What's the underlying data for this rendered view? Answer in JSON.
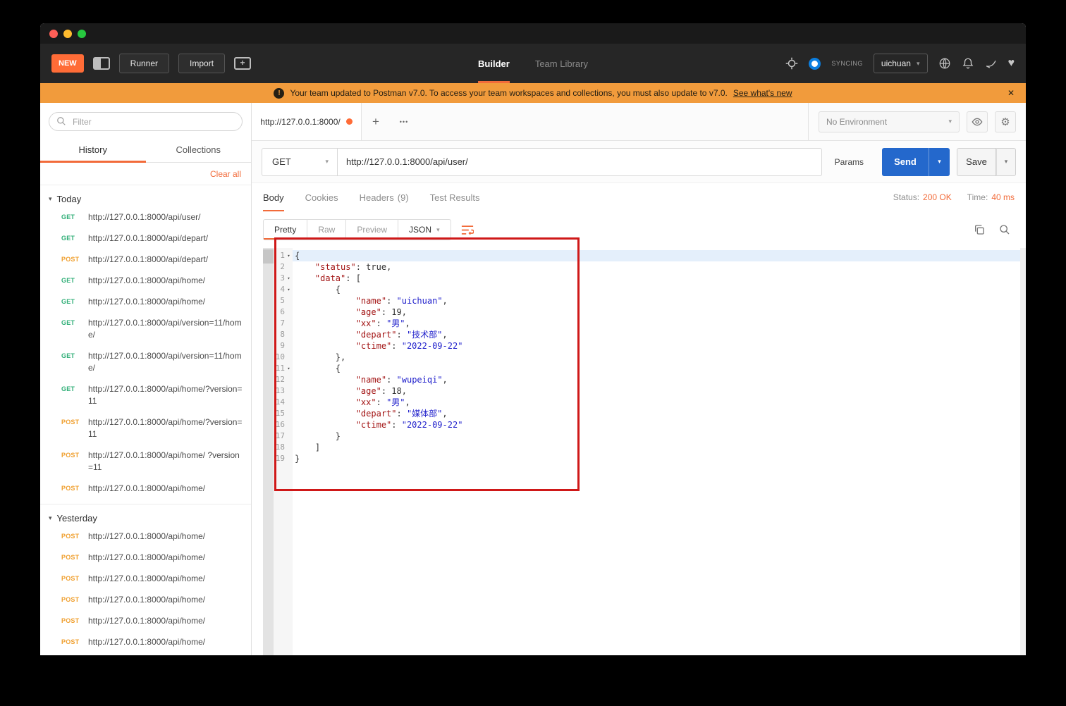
{
  "colors": {
    "accent_orange": "#f26b3a",
    "banner_orange": "#f19b3c",
    "send_blue": "#2468cc",
    "method_get_green": "#2eae76",
    "method_post_orange": "#f0a030",
    "annotation_red": "#cf1818"
  },
  "toolbar": {
    "new_label": "NEW",
    "runner_label": "Runner",
    "import_label": "Import",
    "builder_label": "Builder",
    "team_library_label": "Team Library",
    "syncing_label": "SYNCING",
    "user_label": "uichuan"
  },
  "banner": {
    "text": "Your team updated to Postman v7.0. To access your team workspaces and collections, you must also update to v7.0.",
    "link_label": "See what's new",
    "close_glyph": "✕"
  },
  "sidebar": {
    "filter_placeholder": "Filter",
    "tabs": [
      "History",
      "Collections"
    ],
    "clear_all_label": "Clear all",
    "section_fold_glyph": "▾",
    "sections": [
      {
        "label": "Today",
        "items": [
          {
            "method": "GET",
            "url": "http://127.0.0.1:8000/api/user/"
          },
          {
            "method": "GET",
            "url": "http://127.0.0.1:8000/api/depart/"
          },
          {
            "method": "POST",
            "url": "http://127.0.0.1:8000/api/depart/"
          },
          {
            "method": "GET",
            "url": "http://127.0.0.1:8000/api/home/"
          },
          {
            "method": "GET",
            "url": "http://127.0.0.1:8000/api/home/"
          },
          {
            "method": "GET",
            "url": "http://127.0.0.1:8000/api/version=11/home/"
          },
          {
            "method": "GET",
            "url": "http://127.0.0.1:8000/api/version=11/home/"
          },
          {
            "method": "GET",
            "url": "http://127.0.0.1:8000/api/home/?version=11"
          },
          {
            "method": "POST",
            "url": "http://127.0.0.1:8000/api/home/?version=11"
          },
          {
            "method": "POST",
            "url": "http://127.0.0.1:8000/api/home/ ?version=11"
          },
          {
            "method": "POST",
            "url": "http://127.0.0.1:8000/api/home/"
          }
        ]
      },
      {
        "label": "Yesterday",
        "items": [
          {
            "method": "POST",
            "url": "http://127.0.0.1:8000/api/home/"
          },
          {
            "method": "POST",
            "url": "http://127.0.0.1:8000/api/home/"
          },
          {
            "method": "POST",
            "url": "http://127.0.0.1:8000/api/home/"
          },
          {
            "method": "POST",
            "url": "http://127.0.0.1:8000/api/home/"
          },
          {
            "method": "POST",
            "url": "http://127.0.0.1:8000/api/home/"
          },
          {
            "method": "POST",
            "url": "http://127.0.0.1:8000/api/home/"
          }
        ]
      }
    ]
  },
  "request": {
    "tab_title": "http://127.0.0.1:8000/",
    "new_tab_glyph": "+",
    "tab_menu_glyph": "•••",
    "environment": "No Environment",
    "method": "GET",
    "url": "http://127.0.0.1:8000/api/user/",
    "params_label": "Params",
    "send_label": "Send",
    "save_label": "Save"
  },
  "response": {
    "tabs": [
      "Body",
      "Cookies",
      "Headers",
      "Test Results"
    ],
    "headers_count": "(9)",
    "status_label": "Status:",
    "status_value": "200 OK",
    "time_label": "Time:",
    "time_value": "40 ms",
    "view_tabs": [
      "Pretty",
      "Raw",
      "Preview"
    ],
    "format_label": "JSON",
    "code_lines": [
      {
        "n": "1",
        "fold": true,
        "highlight": true,
        "tokens": [
          {
            "t": "p",
            "v": "{"
          }
        ]
      },
      {
        "n": "2",
        "fold": false,
        "tokens": [
          {
            "t": "p",
            "v": "    "
          },
          {
            "t": "key",
            "v": "\"status\""
          },
          {
            "t": "p",
            "v": ": "
          },
          {
            "t": "bool",
            "v": "true"
          },
          {
            "t": "p",
            "v": ","
          }
        ]
      },
      {
        "n": "3",
        "fold": true,
        "tokens": [
          {
            "t": "p",
            "v": "    "
          },
          {
            "t": "key",
            "v": "\"data\""
          },
          {
            "t": "p",
            "v": ": ["
          }
        ]
      },
      {
        "n": "4",
        "fold": true,
        "tokens": [
          {
            "t": "p",
            "v": "        {"
          }
        ]
      },
      {
        "n": "5",
        "fold": false,
        "tokens": [
          {
            "t": "p",
            "v": "            "
          },
          {
            "t": "key",
            "v": "\"name\""
          },
          {
            "t": "p",
            "v": ": "
          },
          {
            "t": "str",
            "v": "\"uichuan\""
          },
          {
            "t": "p",
            "v": ","
          }
        ]
      },
      {
        "n": "6",
        "fold": false,
        "tokens": [
          {
            "t": "p",
            "v": "            "
          },
          {
            "t": "key",
            "v": "\"age\""
          },
          {
            "t": "p",
            "v": ": "
          },
          {
            "t": "num",
            "v": "19"
          },
          {
            "t": "p",
            "v": ","
          }
        ]
      },
      {
        "n": "7",
        "fold": false,
        "tokens": [
          {
            "t": "p",
            "v": "            "
          },
          {
            "t": "key",
            "v": "\"xx\""
          },
          {
            "t": "p",
            "v": ": "
          },
          {
            "t": "str",
            "v": "\"男\""
          },
          {
            "t": "p",
            "v": ","
          }
        ]
      },
      {
        "n": "8",
        "fold": false,
        "tokens": [
          {
            "t": "p",
            "v": "            "
          },
          {
            "t": "key",
            "v": "\"depart\""
          },
          {
            "t": "p",
            "v": ": "
          },
          {
            "t": "str",
            "v": "\"技术部\""
          },
          {
            "t": "p",
            "v": ","
          }
        ]
      },
      {
        "n": "9",
        "fold": false,
        "tokens": [
          {
            "t": "p",
            "v": "            "
          },
          {
            "t": "key",
            "v": "\"ctime\""
          },
          {
            "t": "p",
            "v": ": "
          },
          {
            "t": "str",
            "v": "\"2022-09-22\""
          }
        ]
      },
      {
        "n": "10",
        "fold": false,
        "tokens": [
          {
            "t": "p",
            "v": "        },"
          }
        ]
      },
      {
        "n": "11",
        "fold": true,
        "tokens": [
          {
            "t": "p",
            "v": "        {"
          }
        ]
      },
      {
        "n": "12",
        "fold": false,
        "tokens": [
          {
            "t": "p",
            "v": "            "
          },
          {
            "t": "key",
            "v": "\"name\""
          },
          {
            "t": "p",
            "v": ": "
          },
          {
            "t": "str",
            "v": "\"wupeiqi\""
          },
          {
            "t": "p",
            "v": ","
          }
        ]
      },
      {
        "n": "13",
        "fold": false,
        "tokens": [
          {
            "t": "p",
            "v": "            "
          },
          {
            "t": "key",
            "v": "\"age\""
          },
          {
            "t": "p",
            "v": ": "
          },
          {
            "t": "num",
            "v": "18"
          },
          {
            "t": "p",
            "v": ","
          }
        ]
      },
      {
        "n": "14",
        "fold": false,
        "tokens": [
          {
            "t": "p",
            "v": "            "
          },
          {
            "t": "key",
            "v": "\"xx\""
          },
          {
            "t": "p",
            "v": ": "
          },
          {
            "t": "str",
            "v": "\"男\""
          },
          {
            "t": "p",
            "v": ","
          }
        ]
      },
      {
        "n": "15",
        "fold": false,
        "tokens": [
          {
            "t": "p",
            "v": "            "
          },
          {
            "t": "key",
            "v": "\"depart\""
          },
          {
            "t": "p",
            "v": ": "
          },
          {
            "t": "str",
            "v": "\"媒体部\""
          },
          {
            "t": "p",
            "v": ","
          }
        ]
      },
      {
        "n": "16",
        "fold": false,
        "tokens": [
          {
            "t": "p",
            "v": "            "
          },
          {
            "t": "key",
            "v": "\"ctime\""
          },
          {
            "t": "p",
            "v": ": "
          },
          {
            "t": "str",
            "v": "\"2022-09-22\""
          }
        ]
      },
      {
        "n": "17",
        "fold": false,
        "tokens": [
          {
            "t": "p",
            "v": "        }"
          }
        ]
      },
      {
        "n": "18",
        "fold": false,
        "tokens": [
          {
            "t": "p",
            "v": "    ]"
          }
        ]
      },
      {
        "n": "19",
        "fold": false,
        "tokens": [
          {
            "t": "p",
            "v": "}"
          }
        ]
      }
    ]
  }
}
